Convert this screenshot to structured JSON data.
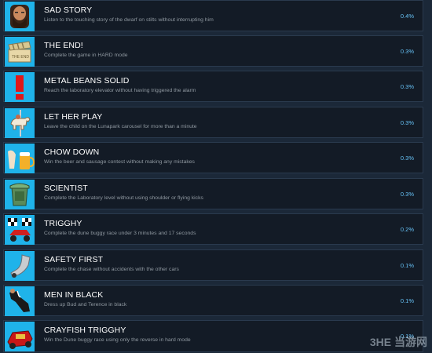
{
  "achievements": [
    {
      "title": "SAD STORY",
      "description": "Listen to the touching story of the dwarf on stilts without interrupting him",
      "percent": "0.4%",
      "icon": "bearded-man-portrait-icon"
    },
    {
      "title": "THE END!",
      "description": "Complete the game in HARD mode",
      "percent": "0.3%",
      "icon": "clapperboard-icon"
    },
    {
      "title": "METAL BEANS SOLID",
      "description": "Reach the laboratory elevator without having triggered the alarm",
      "percent": "0.3%",
      "icon": "exclamation-icon"
    },
    {
      "title": "LET HER PLAY",
      "description": "Leave the child on the Lunapark carousel for more than a minute",
      "percent": "0.3%",
      "icon": "carousel-horse-icon"
    },
    {
      "title": "CHOW DOWN",
      "description": "Win the beer and sausage contest without making any mistakes",
      "percent": "0.3%",
      "icon": "beer-mug-icon"
    },
    {
      "title": "SCIENTIST",
      "description": "Complete the Laboratory level without using shoulder or flying kicks",
      "percent": "0.3%",
      "icon": "lab-flask-icon"
    },
    {
      "title": "TRIGGHY",
      "description": "Complete the dune buggy race under 3 minutes and 17 seconds",
      "percent": "0.2%",
      "icon": "checkered-flag-buggy-icon"
    },
    {
      "title": "SAFETY FIRST",
      "description": "Complete the chase without accidents with the other cars",
      "percent": "0.1%",
      "icon": "crashed-car-icon"
    },
    {
      "title": "MEN IN BLACK",
      "description": "Dress up Bud and Terence in black",
      "percent": "0.1%",
      "icon": "black-suit-icon"
    },
    {
      "title": "CRAYFISH TRIGGHY",
      "description": "Win the Dune buggy race using only the reverse in hard mode",
      "percent": "0.1%",
      "icon": "red-buggy-icon"
    }
  ],
  "watermark": "3HE 当游网",
  "colors": {
    "background": "#1b2838",
    "row": "#131b26",
    "icon_bg": "#1fb3ea",
    "percent": "#66c0f4"
  }
}
